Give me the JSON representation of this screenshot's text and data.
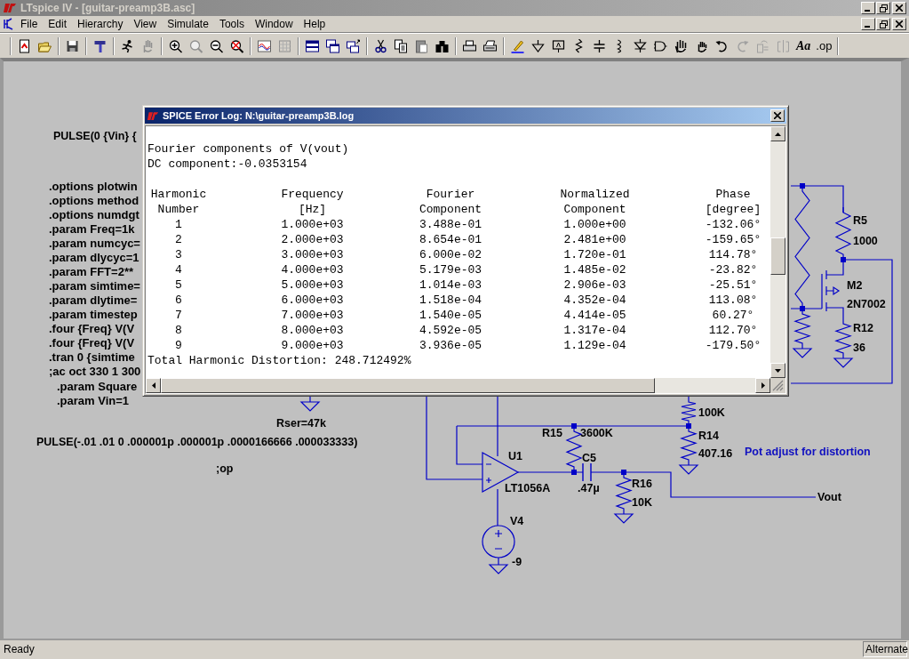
{
  "window": {
    "title": "LTspice IV - [guitar-preamp3B.asc]"
  },
  "menu": [
    "File",
    "Edit",
    "Hierarchy",
    "View",
    "Simulate",
    "Tools",
    "Window",
    "Help"
  ],
  "toolbar": {
    "text_buttons": [
      "Aa",
      ".op"
    ]
  },
  "schematic": {
    "source_directive": "PULSE(0 {Vin} {",
    "directive_block": [
      ".options plotwin",
      ".options method",
      ".options numdgt",
      ".param Freq=1k",
      ".param numcyc=",
      ".param dlycyc=1",
      ".param FFT=2**",
      ".param simtime=",
      ".param dlytime=",
      ".param timestep",
      ".four {Freq}  V(V",
      ".four {Freq}  V(V",
      ".tran 0 {simtime",
      ";ac oct 330 1 300"
    ],
    "param_block": [
      ".param Square",
      ".param Vin=1"
    ],
    "labels": [
      {
        "text": "Rser=47k",
        "kind": "label"
      },
      {
        "text": "PULSE(-.01 .01 0 .000001p .000001p .0000166666 .000033333)",
        "kind": "label"
      },
      {
        "text": ";op",
        "kind": "label"
      },
      {
        "text": "R5",
        "kind": "label"
      },
      {
        "text": "1000",
        "kind": "label"
      },
      {
        "text": "M2",
        "kind": "label"
      },
      {
        "text": "2N7002",
        "kind": "label"
      },
      {
        "text": "R12",
        "kind": "label"
      },
      {
        "text": "36",
        "kind": "label"
      },
      {
        "text": "100K",
        "kind": "label"
      },
      {
        "text": "R14",
        "kind": "label"
      },
      {
        "text": "407.16",
        "kind": "label"
      },
      {
        "text": "Pot adjust for distortion",
        "kind": "comment"
      },
      {
        "text": "R15",
        "kind": "label"
      },
      {
        "text": "3600K",
        "kind": "label"
      },
      {
        "text": "U1",
        "kind": "label"
      },
      {
        "text": "C5",
        "kind": "label"
      },
      {
        "text": "LT1056A",
        "kind": "label"
      },
      {
        "text": ".47µ",
        "kind": "label"
      },
      {
        "text": "R16",
        "kind": "label"
      },
      {
        "text": "10K",
        "kind": "label"
      },
      {
        "text": "Vout",
        "kind": "label"
      },
      {
        "text": "V4",
        "kind": "label"
      },
      {
        "text": "-9",
        "kind": "label"
      }
    ]
  },
  "error_log": {
    "title": "SPICE Error Log: N:\\guitar-preamp3B.log",
    "lines": [
      "Fourier components of V(vout)",
      "DC component:-0.0353154"
    ],
    "columns": [
      {
        "top": "Harmonic",
        "bottom": "Number"
      },
      {
        "top": "Frequency",
        "bottom": "[Hz]"
      },
      {
        "top": "Fourier",
        "bottom": "Component"
      },
      {
        "top": "Normalized",
        "bottom": "Component"
      },
      {
        "top": "Phase",
        "bottom": "[degree]"
      }
    ],
    "rows": [
      [
        "1",
        "1.000e+03",
        "3.488e-01",
        "1.000e+00",
        "-132.06°"
      ],
      [
        "2",
        "2.000e+03",
        "8.654e-01",
        "2.481e+00",
        "-159.65°"
      ],
      [
        "3",
        "3.000e+03",
        "6.000e-02",
        "1.720e-01",
        "114.78°"
      ],
      [
        "4",
        "4.000e+03",
        "5.179e-03",
        "1.485e-02",
        "-23.82°"
      ],
      [
        "5",
        "5.000e+03",
        "1.014e-03",
        "2.906e-03",
        "-25.51°"
      ],
      [
        "6",
        "6.000e+03",
        "1.518e-04",
        "4.352e-04",
        "113.08°"
      ],
      [
        "7",
        "7.000e+03",
        "1.540e-05",
        "4.414e-05",
        "60.27°"
      ],
      [
        "8",
        "8.000e+03",
        "4.592e-05",
        "1.317e-04",
        "112.70°"
      ],
      [
        "9",
        "9.000e+03",
        "3.936e-05",
        "1.129e-04",
        "-179.50°"
      ]
    ],
    "summary": "Total Harmonic Distortion: 248.712492%"
  },
  "status_bar": {
    "message": "Ready",
    "mode": "Alternate"
  }
}
